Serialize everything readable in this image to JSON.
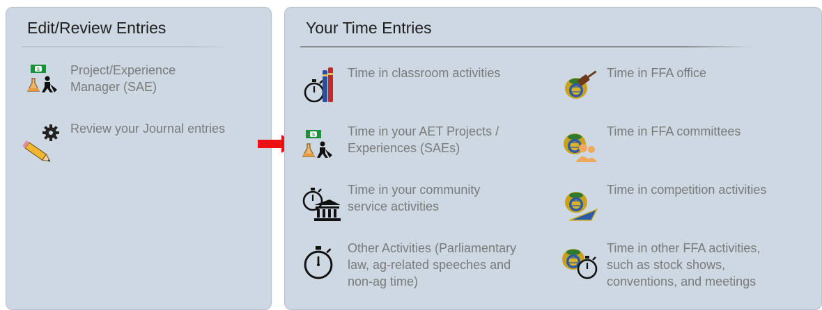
{
  "left_panel": {
    "title": "Edit/Review Entries",
    "items": [
      {
        "label": "Project/Experience\nManager (SAE)",
        "icon": "sae-project-icon"
      },
      {
        "label": "Review your Journal entries",
        "icon": "journal-pencil-gear-icon"
      }
    ]
  },
  "right_panel": {
    "title": "Your Time Entries",
    "items": [
      {
        "label": "Time in classroom activities",
        "icon": "stopwatch-books-icon"
      },
      {
        "label": "Time in FFA office",
        "icon": "ffa-emblem-gavel-icon"
      },
      {
        "label": "Time in your AET Projects /\nExperiences (SAEs)",
        "icon": "sae-project-icon"
      },
      {
        "label": "Time in FFA committees",
        "icon": "ffa-emblem-people-icon"
      },
      {
        "label": "Time in your community\nservice activities",
        "icon": "stopwatch-building-icon"
      },
      {
        "label": "Time in competition activities",
        "icon": "ffa-emblem-pennant-icon"
      },
      {
        "label": "Other Activities (Parliamentary\nlaw, ag-related speeches and\nnon-ag time)",
        "icon": "stopwatch-icon"
      },
      {
        "label": "Time in other FFA activities,\nsuch as stock shows,\nconventions, and meetings",
        "icon": "ffa-emblem-stopwatch-icon"
      }
    ]
  },
  "colors": {
    "panel_bg": "#cdd8e3",
    "link_text": "#7a7a7a",
    "arrow": "#ee1111"
  }
}
